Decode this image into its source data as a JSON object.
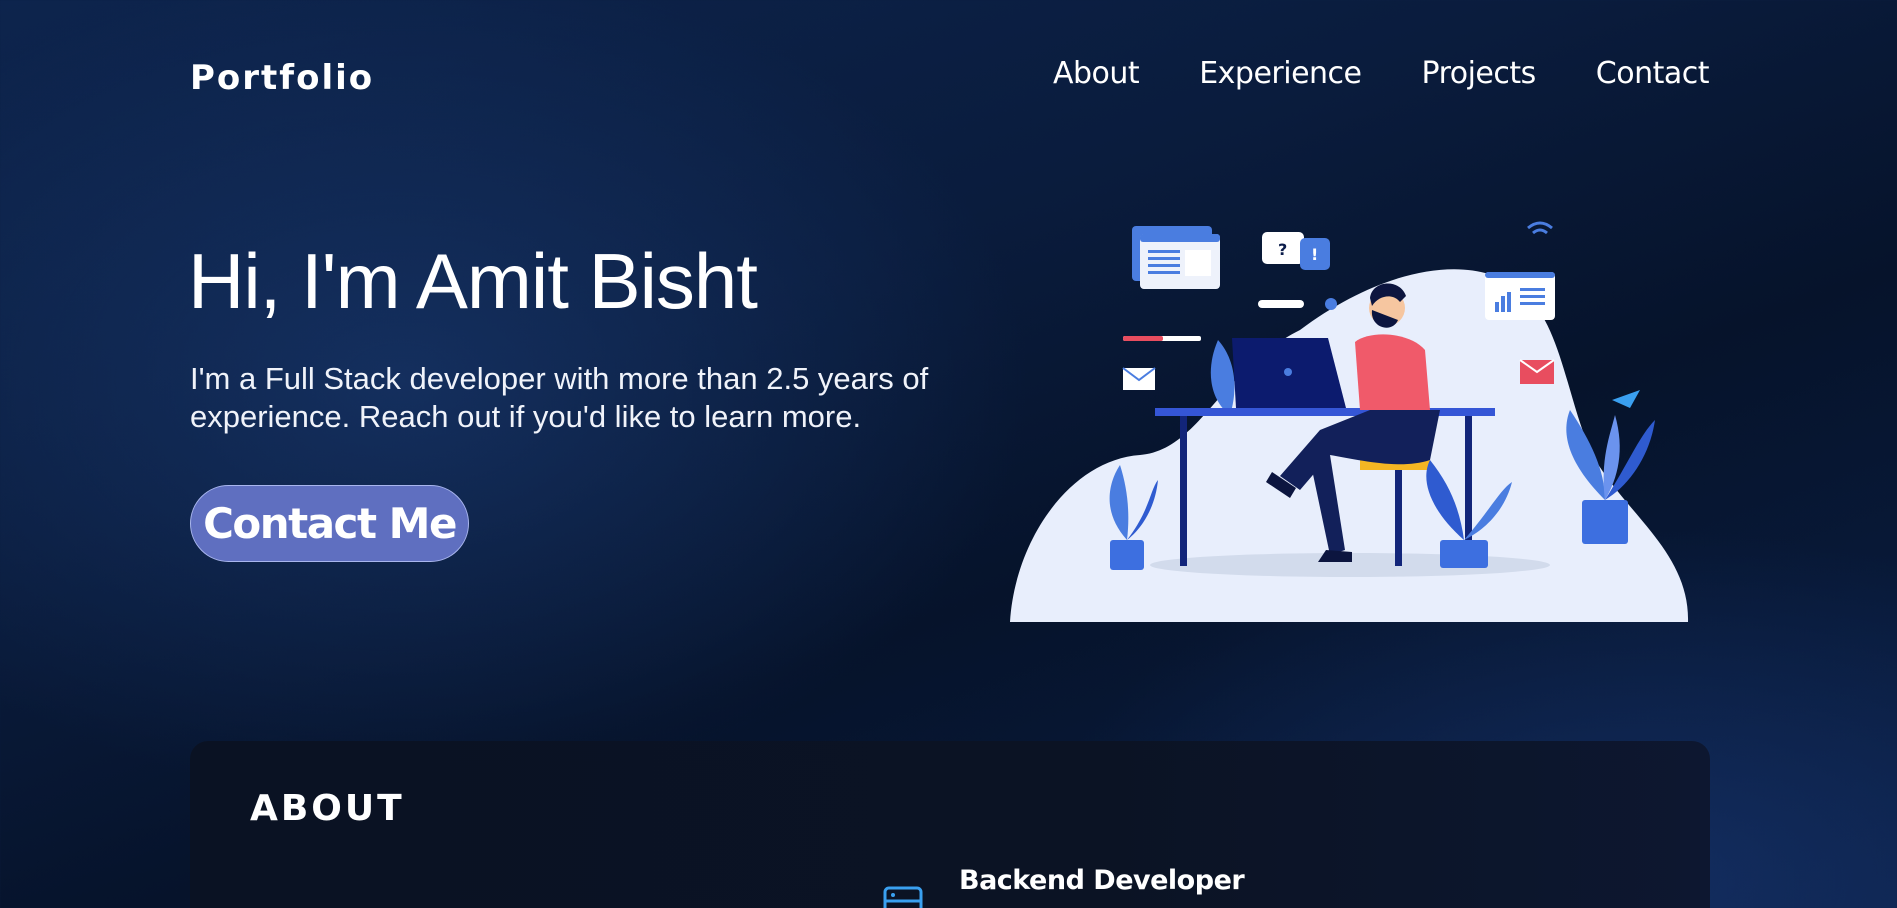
{
  "nav": {
    "logo": "Portfolio",
    "links": [
      "About",
      "Experience",
      "Projects",
      "Contact"
    ]
  },
  "hero": {
    "title": "Hi, I'm Amit Bisht",
    "description": "I'm a Full Stack developer with more than 2.5 years of experience. Reach out if you'd like to learn more.",
    "cta_label": "Contact Me",
    "illustration_icon": "developer-at-desk-illustration"
  },
  "about": {
    "title": "ABOUT",
    "roles": [
      {
        "title": "Backend Developer",
        "icon": "server-icon"
      }
    ]
  },
  "colors": {
    "background": "#0a1c3d",
    "accent": "#5f6fc0",
    "card": "#0a1223",
    "icon_blue": "#3aa0f0"
  }
}
